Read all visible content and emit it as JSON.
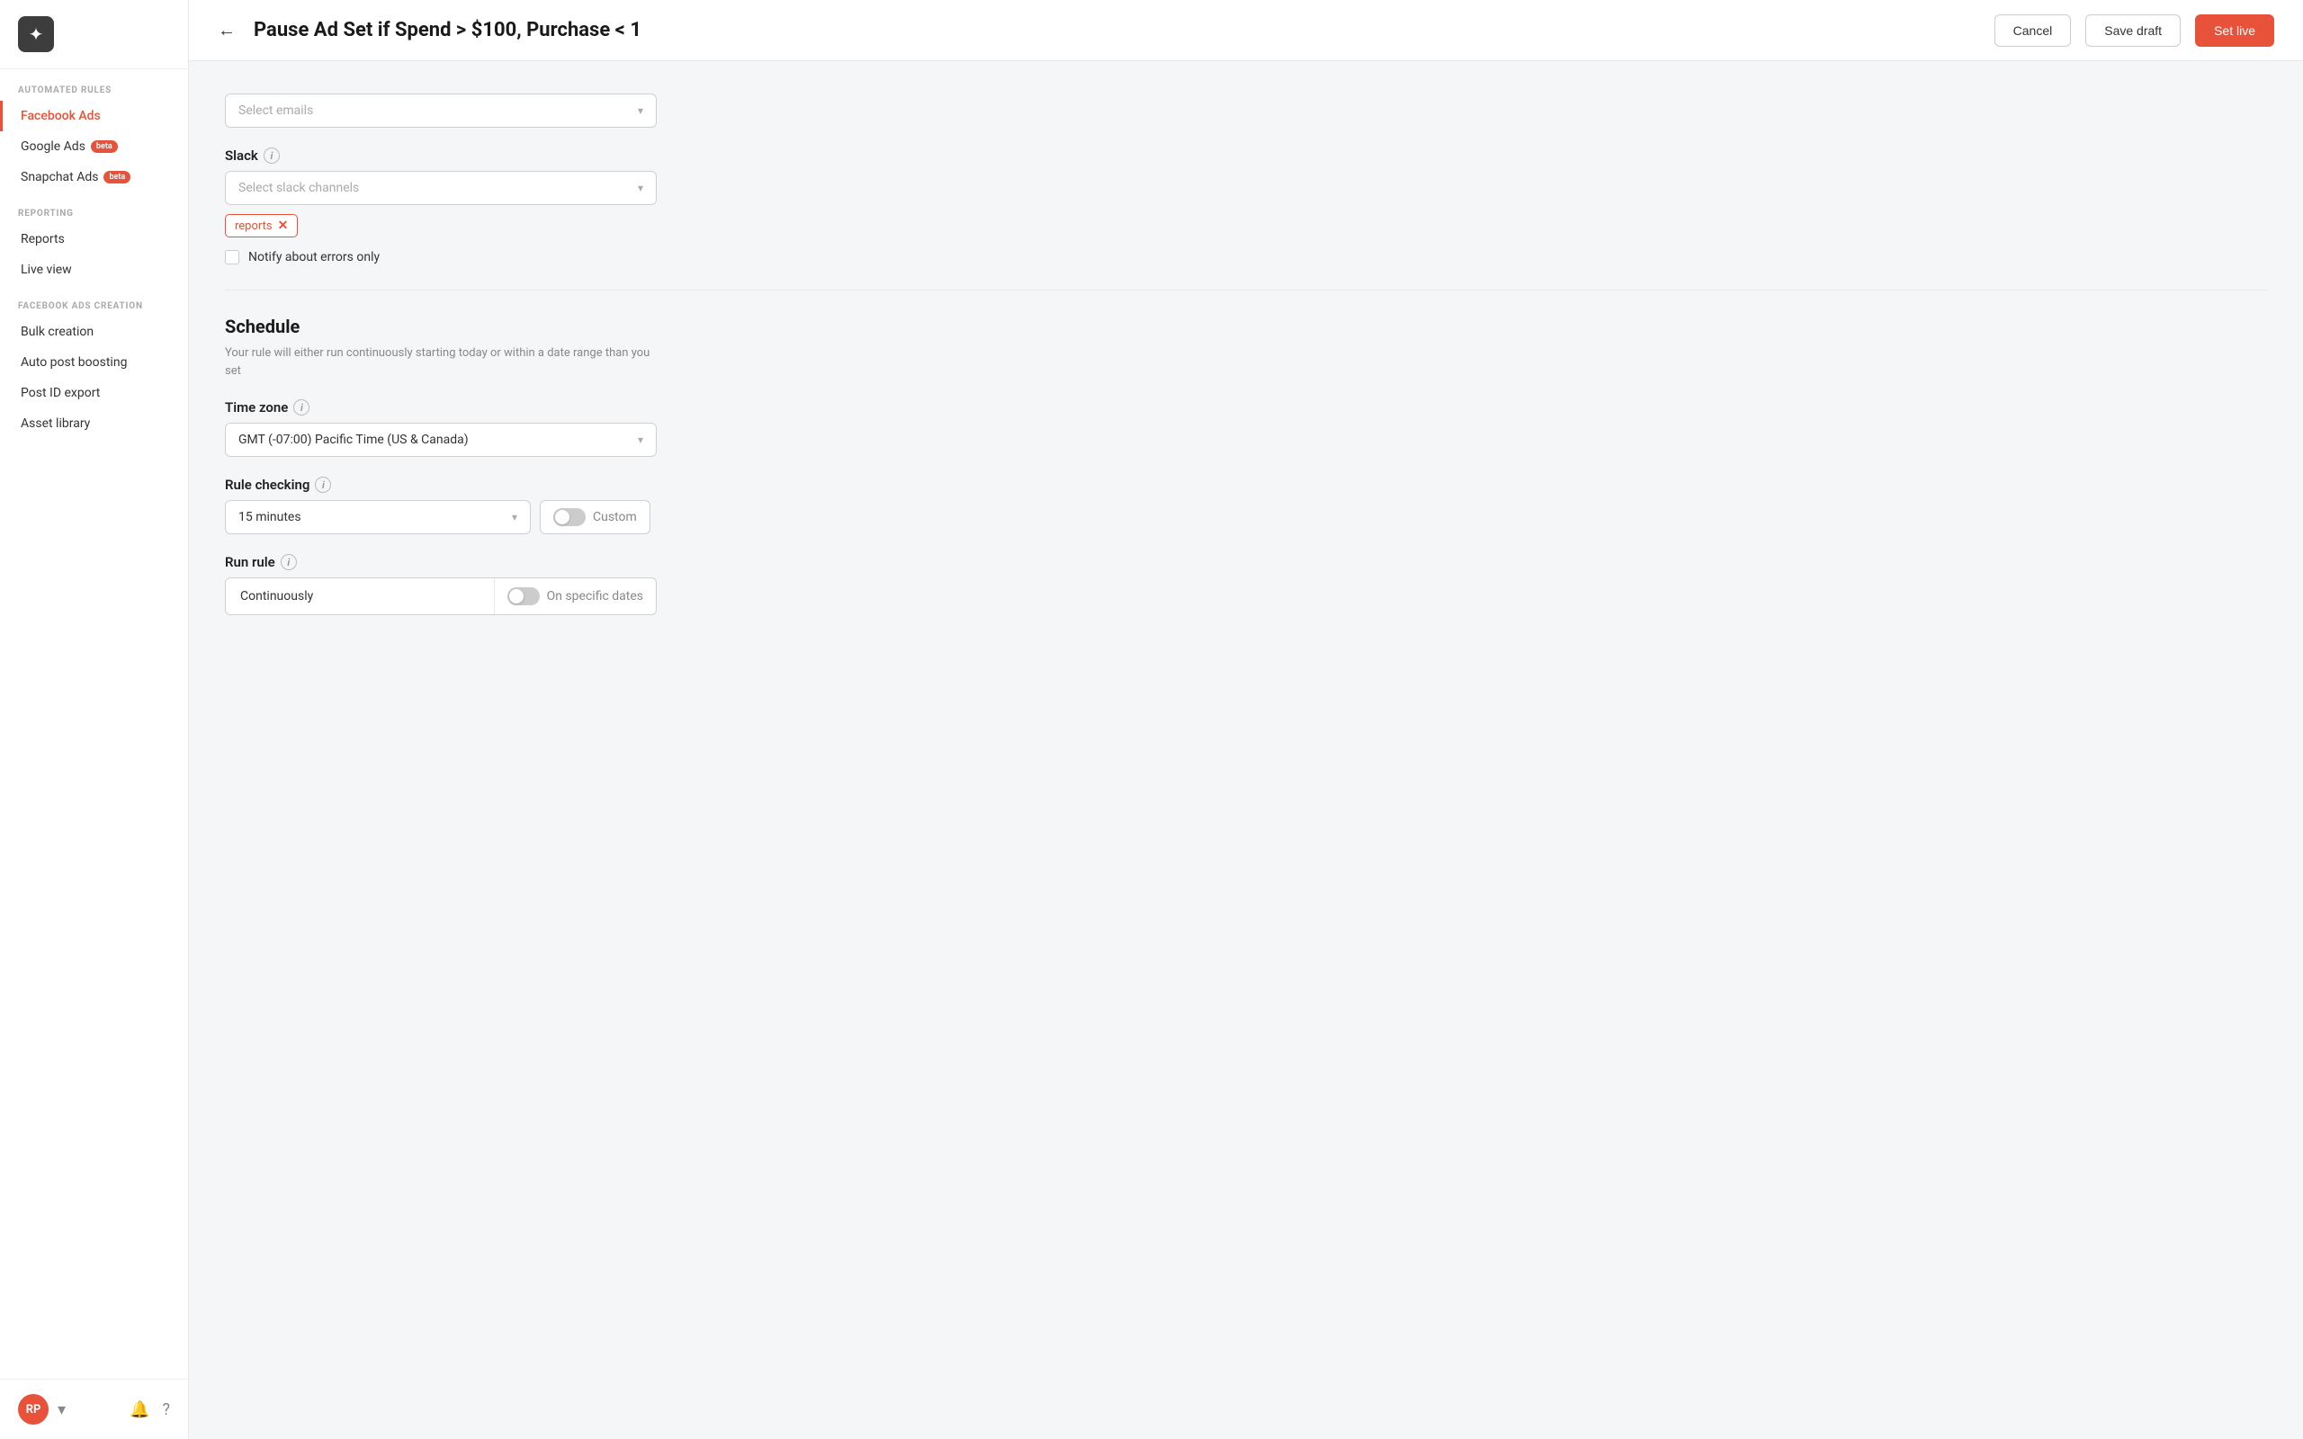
{
  "sidebar": {
    "logo_symbol": "✦",
    "sections": [
      {
        "label": "AUTOMATED RULES",
        "items": [
          {
            "id": "facebook-ads",
            "label": "Facebook Ads",
            "active": true,
            "badge": null
          },
          {
            "id": "google-ads",
            "label": "Google Ads",
            "active": false,
            "badge": "beta"
          },
          {
            "id": "snapchat-ads",
            "label": "Snapchat Ads",
            "active": false,
            "badge": "beta"
          }
        ]
      },
      {
        "label": "REPORTING",
        "items": [
          {
            "id": "reports",
            "label": "Reports",
            "active": false,
            "badge": null
          },
          {
            "id": "live-view",
            "label": "Live view",
            "active": false,
            "badge": null
          }
        ]
      },
      {
        "label": "FACEBOOK ADS CREATION",
        "items": [
          {
            "id": "bulk-creation",
            "label": "Bulk creation",
            "active": false,
            "badge": null
          },
          {
            "id": "auto-post-boosting",
            "label": "Auto post boosting",
            "active": false,
            "badge": null
          },
          {
            "id": "post-id-export",
            "label": "Post ID export",
            "active": false,
            "badge": null
          },
          {
            "id": "asset-library",
            "label": "Asset library",
            "active": false,
            "badge": null
          }
        ]
      }
    ],
    "user_initials": "RP"
  },
  "header": {
    "title": "Pause Ad Set if Spend > $100, Purchase < 1",
    "back_label": "←",
    "cancel_label": "Cancel",
    "save_draft_label": "Save draft",
    "set_live_label": "Set live"
  },
  "notifications": {
    "emails_placeholder": "Select emails",
    "slack_label": "Slack",
    "slack_info": "i",
    "slack_placeholder": "Select slack channels",
    "slack_tags": [
      {
        "id": "reports",
        "label": "reports"
      }
    ],
    "notify_errors_label": "Notify about errors only"
  },
  "schedule": {
    "section_title": "Schedule",
    "section_desc": "Your rule will either run continuously starting today or within a date range than you set",
    "timezone_label": "Time zone",
    "timezone_info": "i",
    "timezone_value": "GMT (-07:00) Pacific Time (US & Canada)",
    "rule_checking_label": "Rule checking",
    "rule_checking_info": "i",
    "rule_checking_value": "15 minutes",
    "custom_label": "Custom",
    "run_rule_label": "Run rule",
    "run_rule_info": "i",
    "continuously_label": "Continuously",
    "on_specific_dates_label": "On specific dates"
  }
}
